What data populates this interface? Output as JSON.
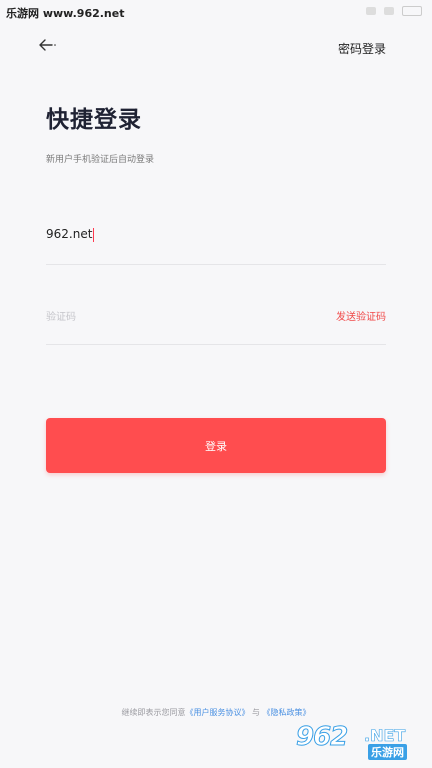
{
  "status_bar": {
    "site": "乐游网 www.962.net"
  },
  "header": {
    "back_icon": "arrow-left-icon",
    "password_login": "密码登录"
  },
  "main": {
    "title": "快捷登录",
    "subtitle": "新用户手机验证后自动登录",
    "phone_value": "962.net",
    "code_placeholder": "验证码",
    "send_code": "发送验证码",
    "login_button": "登录"
  },
  "footer": {
    "agreement_prefix": "继续即表示您同意",
    "user_agreement": "《用户服务协议》",
    "and": " 与 ",
    "privacy_policy": "《隐私政策》"
  },
  "watermark": {
    "number": "962",
    "domain": ".NET",
    "name": "乐游网"
  },
  "colors": {
    "accent": "#ff4d4f",
    "send_code": "#f04848",
    "link": "#4a90e2",
    "background": "#f7f7f9"
  }
}
